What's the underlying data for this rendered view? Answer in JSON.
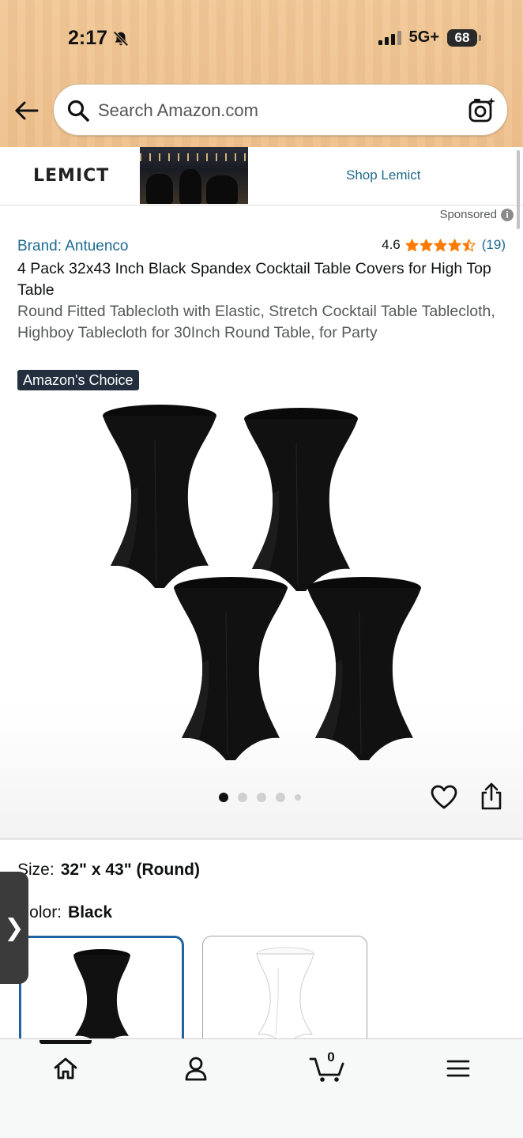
{
  "status_bar": {
    "time": "2:17",
    "network": "5G+",
    "battery": "68"
  },
  "search": {
    "placeholder": "Search Amazon.com"
  },
  "sponsored_banner": {
    "brand_logo": "LEMICT",
    "link_label": "Shop Lemict",
    "sponsored_label": "Sponsored",
    "info_glyph": "i"
  },
  "product": {
    "brand": "Brand: Antuenco",
    "rating": "4.6",
    "stars": 4.5,
    "review_count": "(19)",
    "title": "4 Pack 32x43 Inch Black Spandex Cocktail Table Covers for High Top Table",
    "subtitle": "Round Fitted Tablecloth with Elastic, Stretch Cocktail Table Tablecloth, Highboy Tablecloth for 30Inch Round Table, for Party",
    "badge": "Amazon's Choice",
    "image_count": 5,
    "active_image": 1
  },
  "variations": {
    "size_label": "Size:",
    "size_value": "32\" x 43\" (Round)",
    "color_label": "Color:",
    "color_value": "Black",
    "swatches": [
      {
        "name": "Black",
        "selected": true
      },
      {
        "name": "White",
        "selected": false
      }
    ]
  },
  "side_tab_glyph": "❯",
  "bottom_nav": {
    "cart_count": "0",
    "active": "home"
  },
  "colors": {
    "header": "#f1c796",
    "link": "#1b6a92",
    "badge": "#232f3e",
    "star": "#ff7a00",
    "selected_border": "#2162a1"
  },
  "icons": [
    "back-arrow-icon",
    "search-icon",
    "camera-icon",
    "bell-muted-icon",
    "signal-icon",
    "battery-icon",
    "info-icon",
    "star-icon",
    "heart-icon",
    "share-icon",
    "home-icon",
    "account-icon",
    "cart-icon",
    "menu-icon"
  ]
}
